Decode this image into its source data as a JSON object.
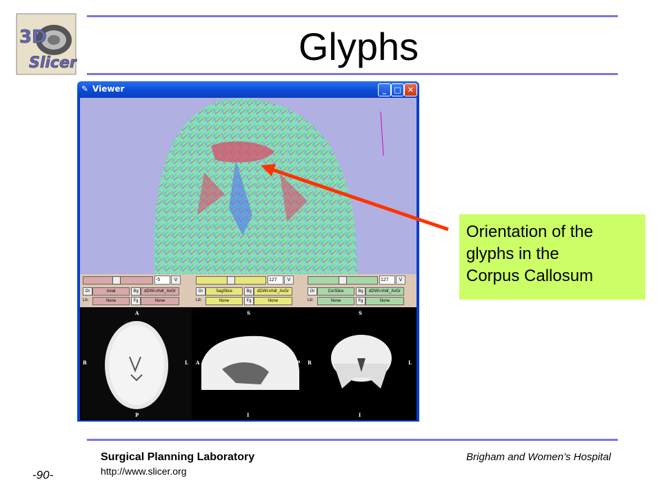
{
  "slide": {
    "title": "Glyphs",
    "logo_text": [
      "3D",
      "Slicer"
    ],
    "page_number": "-90-"
  },
  "viewer": {
    "window_title": "Viewer",
    "controls": [
      {
        "slider_value": "-5",
        "v": "V",
        "or": "Or",
        "orient": "Axial",
        "bg": "Bg",
        "bg_volume": "dDWI-nhdr_AvGr",
        "lb": "Lb:",
        "lb_value": "None",
        "fg": "Fg",
        "fg_value": "None",
        "color": "#d9a8a8"
      },
      {
        "slider_value": "127",
        "v": "V",
        "or": "Or",
        "orient": "SagSlice",
        "bg": "Bg",
        "bg_volume": "dDWI-nhdr_AvGr",
        "lb": "Lb:",
        "lb_value": "None",
        "fg": "Fg",
        "fg_value": "None",
        "color": "#e8e87a"
      },
      {
        "slider_value": "127",
        "v": "V",
        "or": "Or",
        "orient": "CorSlice",
        "bg": "Bg",
        "bg_volume": "dDWI-nhdr_AvGr",
        "lb": "Lb:",
        "lb_value": "None",
        "fg": "Fg",
        "fg_value": "None",
        "color": "#a8d8a8"
      }
    ],
    "slice_views": [
      {
        "top": "A",
        "bottom": "P",
        "left": "R",
        "right": "L"
      },
      {
        "top": "S",
        "bottom": "I",
        "left": "A",
        "right": "P"
      },
      {
        "top": "S",
        "bottom": "I",
        "left": "R",
        "right": "L"
      }
    ]
  },
  "callout": {
    "lines": [
      "Orientation of the",
      "glyphs in the",
      "Corpus Callosum"
    ],
    "bg_color": "#ccff66",
    "arrow_color": "#ff3300"
  },
  "footer": {
    "lab": "Surgical Planning Laboratory",
    "url": "http://www.slicer.org",
    "hospital": "Brigham and Women’s Hospital"
  }
}
